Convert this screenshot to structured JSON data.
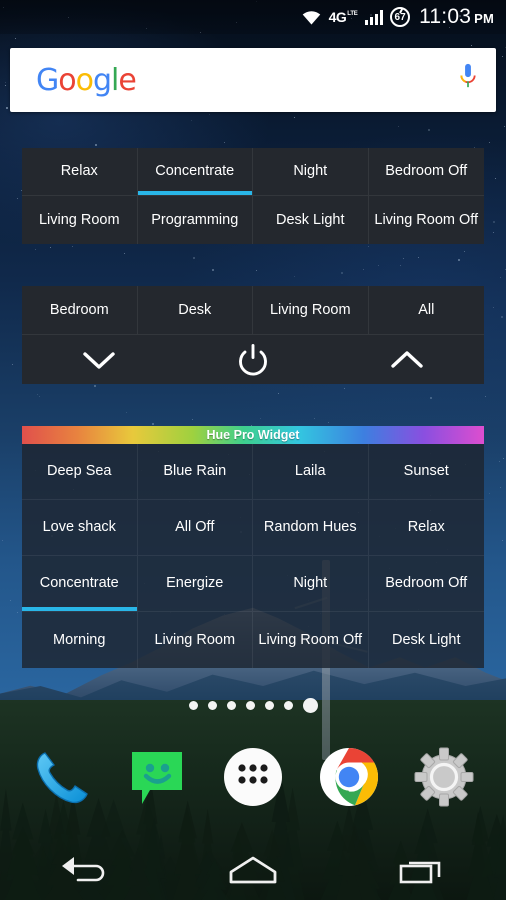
{
  "statusbar": {
    "wifi_icon": "wifi-icon",
    "network_label": "4G",
    "network_sub": "LTE",
    "signal_icon": "signal-bars-icon",
    "battery_level": "67",
    "time": "11:03",
    "ampm": "PM"
  },
  "search": {
    "logo_letters": [
      {
        "ch": "G",
        "color": "#4285f4"
      },
      {
        "ch": "o",
        "color": "#ea4335"
      },
      {
        "ch": "o",
        "color": "#fbbc05"
      },
      {
        "ch": "g",
        "color": "#4285f4"
      },
      {
        "ch": "l",
        "color": "#34a853"
      },
      {
        "ch": "e",
        "color": "#ea4335"
      }
    ],
    "mic_icon": "microphone-icon"
  },
  "widget_scenes": {
    "name": "scenes-widget",
    "cells": [
      {
        "label": "Relax",
        "active": false
      },
      {
        "label": "Concentrate",
        "active": true
      },
      {
        "label": "Night",
        "active": false
      },
      {
        "label": "Bedroom Off",
        "active": false
      },
      {
        "label": "Living Room",
        "active": false
      },
      {
        "label": "Programming",
        "active": false
      },
      {
        "label": "Desk Light",
        "active": false
      },
      {
        "label": "Living Room Off",
        "active": false
      }
    ]
  },
  "widget_rooms": {
    "name": "rooms-widget",
    "tabs": [
      {
        "label": "Bedroom"
      },
      {
        "label": "Desk"
      },
      {
        "label": "Living Room"
      },
      {
        "label": "All"
      }
    ],
    "controls": [
      {
        "icon": "chevron-down-icon",
        "name": "dim-down-button"
      },
      {
        "icon": "power-icon",
        "name": "power-toggle-button"
      },
      {
        "icon": "chevron-up-icon",
        "name": "brighten-up-button"
      }
    ]
  },
  "widget_huepro": {
    "name": "hue-pro-widget",
    "title": "Hue Pro Widget",
    "cells": [
      {
        "label": "Deep Sea",
        "active": false
      },
      {
        "label": "Blue Rain",
        "active": false
      },
      {
        "label": "Laila",
        "active": false
      },
      {
        "label": "Sunset",
        "active": false
      },
      {
        "label": "Love shack",
        "active": false
      },
      {
        "label": "All Off",
        "active": false
      },
      {
        "label": "Random Hues",
        "active": false
      },
      {
        "label": "Relax",
        "active": false
      },
      {
        "label": "Concentrate",
        "active": true
      },
      {
        "label": "Energize",
        "active": false
      },
      {
        "label": "Night",
        "active": false
      },
      {
        "label": "Bedroom Off",
        "active": false
      },
      {
        "label": "Morning",
        "active": false
      },
      {
        "label": "Living Room",
        "active": false
      },
      {
        "label": "Living Room Off",
        "active": false
      },
      {
        "label": "Desk Light",
        "active": false
      }
    ]
  },
  "pager": {
    "total_pages": 7,
    "current_page": 7
  },
  "dock": [
    {
      "name": "phone-icon",
      "label": "Phone"
    },
    {
      "name": "messaging-icon",
      "label": "Messaging"
    },
    {
      "name": "app-drawer-icon",
      "label": "Apps"
    },
    {
      "name": "chrome-icon",
      "label": "Chrome"
    },
    {
      "name": "settings-icon",
      "label": "Settings"
    }
  ],
  "navbar": [
    {
      "name": "back-icon",
      "label": "Back"
    },
    {
      "name": "home-icon",
      "label": "Home"
    },
    {
      "name": "recents-icon",
      "label": "Recents"
    }
  ],
  "colors": {
    "accent": "#29b6e8",
    "widget_bg": "#24282e",
    "widget_bg_translucent": "rgba(30,38,50,0.84)"
  }
}
